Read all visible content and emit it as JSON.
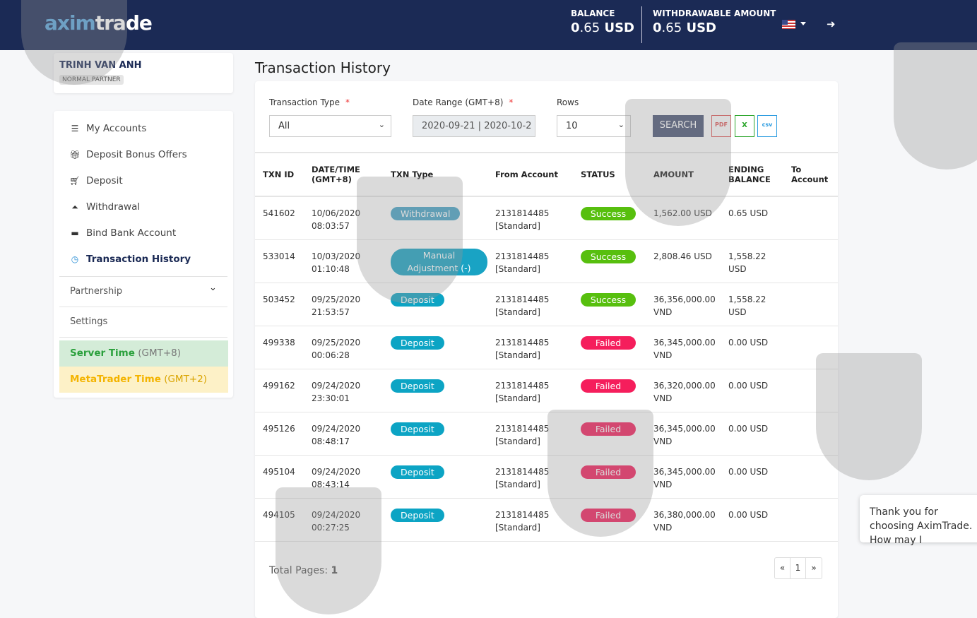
{
  "header": {
    "logo_a": "axim",
    "logo_b": "trade",
    "balance_label": "BALANCE",
    "balance_int": "0",
    "balance_dec": ".65",
    "balance_cur": "USD",
    "withdrawable_label": "WITHDRAWABLE AMOUNT",
    "withdrawable_int": "0",
    "withdrawable_dec": ".65",
    "withdrawable_cur": "USD"
  },
  "user": {
    "name": "TRINH VAN ANH",
    "badge": "NORMAL PARTNER"
  },
  "menu": {
    "items": [
      "My Accounts",
      "Deposit Bonus Offers",
      "Deposit",
      "Withdrawal",
      "Bind Bank Account",
      "Transaction History"
    ],
    "partnership": "Partnership",
    "settings": "Settings",
    "server_time": "Server Time",
    "server_tz": "(GMT+8)",
    "mt_time": "MetaTrader Time",
    "mt_tz": "(GMT+2)"
  },
  "page": {
    "title": "Transaction History"
  },
  "filters": {
    "type_label": "Transaction Type",
    "type_value": "All",
    "date_label": "Date Range (GMT+8)",
    "date_value": "2020-09-21 | 2020-10-2",
    "rows_label": "Rows",
    "rows_value": "10",
    "required": "*",
    "search": "SEARCH",
    "pdf": "PDF",
    "xls": "X",
    "csv": "csv"
  },
  "table": {
    "headers": [
      "TXN ID",
      "DATE/TIME (GMT+8)",
      "TXN Type",
      "From Account",
      "STATUS",
      "AMOUNT",
      "ENDING BALANCE",
      "To Account"
    ],
    "rows": [
      {
        "id": "541602",
        "date": "10/06/2020",
        "time": "08:03:57",
        "type": "Withdrawal",
        "kind": "wd",
        "acct": "2131814485",
        "acct_type": "[Standard]",
        "status": "Success",
        "amount": "1,562.00 USD",
        "ending": "0.65 USD"
      },
      {
        "id": "533014",
        "date": "10/03/2020",
        "time": "01:10:48",
        "type": "Manual Adjustment (-)",
        "kind": "ma",
        "acct": "2131814485",
        "acct_type": "[Standard]",
        "status": "Success",
        "amount": "2,808.46 USD",
        "ending": "1,558.22 USD"
      },
      {
        "id": "503452",
        "date": "09/25/2020",
        "time": "21:53:57",
        "type": "Deposit",
        "kind": "dp",
        "acct": "2131814485",
        "acct_type": "[Standard]",
        "status": "Success",
        "amount": "36,356,000.00 VND",
        "ending": "1,558.22 USD"
      },
      {
        "id": "499338",
        "date": "09/25/2020",
        "time": "00:06:28",
        "type": "Deposit",
        "kind": "dp",
        "acct": "2131814485",
        "acct_type": "[Standard]",
        "status": "Failed",
        "amount": "36,345,000.00 VND",
        "ending": "0.00 USD"
      },
      {
        "id": "499162",
        "date": "09/24/2020",
        "time": "23:30:01",
        "type": "Deposit",
        "kind": "dp",
        "acct": "2131814485",
        "acct_type": "[Standard]",
        "status": "Failed",
        "amount": "36,320,000.00 VND",
        "ending": "0.00 USD"
      },
      {
        "id": "495126",
        "date": "09/24/2020",
        "time": "08:48:17",
        "type": "Deposit",
        "kind": "dp",
        "acct": "2131814485",
        "acct_type": "[Standard]",
        "status": "Failed",
        "amount": "36,345,000.00 VND",
        "ending": "0.00 USD"
      },
      {
        "id": "495104",
        "date": "09/24/2020",
        "time": "08:43:14",
        "type": "Deposit",
        "kind": "dp",
        "acct": "2131814485",
        "acct_type": "[Standard]",
        "status": "Failed",
        "amount": "36,345,000.00 VND",
        "ending": "0.00 USD"
      },
      {
        "id": "494105",
        "date": "09/24/2020",
        "time": "00:27:25",
        "type": "Deposit",
        "kind": "dp",
        "acct": "2131814485",
        "acct_type": "[Standard]",
        "status": "Failed",
        "amount": "36,380,000.00 VND",
        "ending": "0.00 USD"
      }
    ]
  },
  "pagination": {
    "total_label": "Total Pages:",
    "total": "1",
    "prev": "«",
    "current": "1",
    "next": "»"
  },
  "chat": {
    "message": "Thank you for choosing AximTrade. How may I"
  }
}
